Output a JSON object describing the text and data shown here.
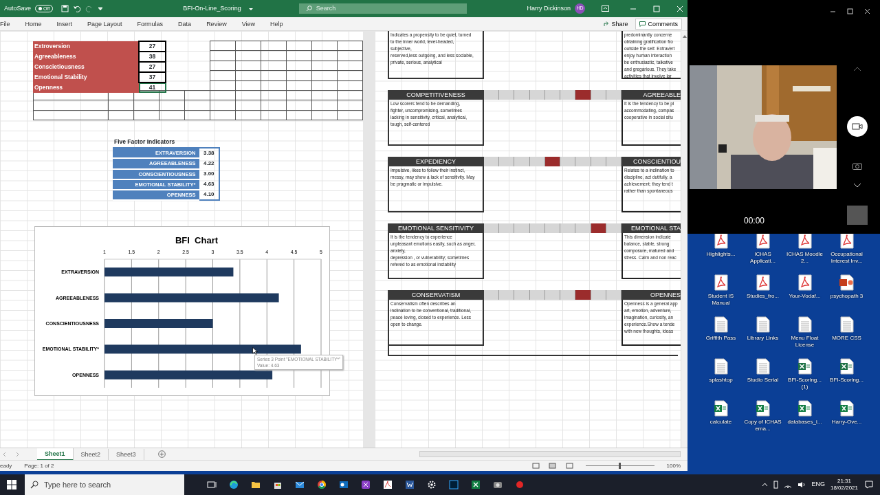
{
  "title_bar": {
    "autosave_label": "AutoSave",
    "autosave_state": "Off",
    "autosave_on": false,
    "filename": "BFI-On-Line_Scoring",
    "search_placeholder": "Search",
    "user": "Harry Dickinson",
    "initials": "HD"
  },
  "ribbon": {
    "tabs": [
      {
        "label": "File",
        "selected": false
      },
      {
        "label": "Home",
        "selected": false
      },
      {
        "label": "Insert",
        "selected": false
      },
      {
        "label": "Page Layout",
        "selected": false
      },
      {
        "label": "Formulas",
        "selected": false
      },
      {
        "label": "Data",
        "selected": false
      },
      {
        "label": "Review",
        "selected": false
      },
      {
        "label": "View",
        "selected": false
      },
      {
        "label": "Help",
        "selected": false
      }
    ],
    "share": "Share",
    "comments": "Comments"
  },
  "raw_scores": [
    {
      "label": "Extroversion",
      "value": "27",
      "selected": false
    },
    {
      "label": "Agreeableness",
      "value": "38",
      "selected": false
    },
    {
      "label": "Conscietiousness",
      "value": "27",
      "selected": false
    },
    {
      "label": "Emotional Stability",
      "value": "37",
      "selected": false
    },
    {
      "label": "Openness",
      "value": "41",
      "selected": true
    }
  ],
  "indicators": {
    "title": "Five Factor Indicators",
    "rows": [
      {
        "label": "EXTRAVERSION",
        "value": "3.38"
      },
      {
        "label": "AGREEABLENESS",
        "value": "4.22"
      },
      {
        "label": "CONSCIENTIOUSNESS",
        "value": "3.00"
      },
      {
        "label": "EMOTIONAL STABILITY*",
        "value": "4.63"
      },
      {
        "label": "OPENNESS",
        "value": "4.10"
      }
    ]
  },
  "chart": {
    "chart_data": {
      "type": "bar",
      "orientation": "horizontal",
      "title": "BFI  Chart",
      "categories": [
        "EXTRAVERSION",
        "AGREEABLENESS",
        "CONSCIENTIOUSNESS",
        "EMOTIONAL STABILITY*",
        "OPENNESS"
      ],
      "series": [
        {
          "color": "#1f3a5f",
          "values": [
            3.38,
            4.22,
            3.0,
            4.63,
            4.1
          ]
        }
      ],
      "grid": true,
      "xlim": [
        1,
        5
      ],
      "xticks": [
        1,
        1.5,
        2,
        2.5,
        3,
        3.5,
        4,
        4.5,
        5
      ]
    },
    "tooltip": {
      "point": "Series 3 Point \"EMOTIONAL STABILITY*\"",
      "value": "Value: 4.63"
    }
  },
  "profile": {
    "top_left": [
      "Indicates a propensity to be quiet, turned",
      "to the inner world, level-headed,",
      "subjective,",
      "reserved,less outgoing, and less sociable,",
      "private, serious, analytical"
    ],
    "top_right": [
      "predominantly concerne",
      "obtaining gratification fro",
      "outside the self. Extravert",
      "enjoy human interaction",
      "be enthusiastic, talkative",
      "and gregarious. They take",
      "activities that involve lar"
    ],
    "scales": [
      {
        "low": "COMPETITIVENESS",
        "low_text": [
          "Low scorers tend to be demanding,",
          "fighter, uncompromising, sometimes",
          "lacking in sensitivity, critical, analytical,",
          "tough, self-centered"
        ],
        "high": "AGREEABLE",
        "high_text": [
          "It is the tendency to be pl",
          "accommodating, compas",
          "cooperative in social situ"
        ],
        "cells": [
          {
            "marked": false
          },
          {
            "marked": false
          },
          {
            "marked": false
          },
          {
            "marked": false
          },
          {
            "marked": false
          },
          {
            "marked": false
          },
          {
            "marked": true
          },
          {
            "marked": false
          },
          {
            "marked": false
          }
        ]
      },
      {
        "low": "EXPEDIENCY",
        "low_text": [
          "Impulsive, likes to follow their instinct,",
          "messy, may show a lack of sensitivity. May",
          "be pragmatic or impulsive."
        ],
        "high": "CONSCIENTIOU",
        "high_text": [
          "Relates to a inclination to",
          "discipline, act dutifully, a",
          "achievement; they tend t",
          "rather than spontaneous"
        ],
        "cells": [
          {
            "marked": false
          },
          {
            "marked": false
          },
          {
            "marked": false
          },
          {
            "marked": false
          },
          {
            "marked": true
          },
          {
            "marked": false
          },
          {
            "marked": false
          },
          {
            "marked": false
          },
          {
            "marked": false
          }
        ]
      },
      {
        "low": "EMOTIONAL SENSITIVITY",
        "low_text": [
          "It is the tendency to experience",
          "unpleasant emotions easily, such as anger,",
          "anxiety,",
          "depression , or vulnerability; sometimes",
          "refered to as emotional instability"
        ],
        "high": "EMOTIONAL STA",
        "high_text": [
          "This dimension indicate",
          "balance, stable, strong",
          "composure, matured and",
          "stress. Calm and non reac"
        ],
        "cells": [
          {
            "marked": false
          },
          {
            "marked": false
          },
          {
            "marked": false
          },
          {
            "marked": false
          },
          {
            "marked": false
          },
          {
            "marked": false
          },
          {
            "marked": false
          },
          {
            "marked": true
          },
          {
            "marked": false
          }
        ]
      },
      {
        "low": "CONSERVATISM",
        "low_text": [
          "Conservatism often describes an",
          "inclination to be conventional, traditional,",
          "peace loving, closed to experience. Less",
          "open to change."
        ],
        "high": "OPENNES",
        "high_text": [
          "Openness is a general app",
          "art, emotion, adventure,",
          "imagination, curiosity, an",
          "experience.Show a tende",
          "with new thoughts, ideas"
        ],
        "cells": [
          {
            "marked": false
          },
          {
            "marked": false
          },
          {
            "marked": false
          },
          {
            "marked": false
          },
          {
            "marked": false
          },
          {
            "marked": false
          },
          {
            "marked": true
          },
          {
            "marked": false
          },
          {
            "marked": false
          }
        ]
      }
    ]
  },
  "sheet_tabs": [
    {
      "label": "Sheet1",
      "selected": true
    },
    {
      "label": "Sheet2",
      "selected": false
    },
    {
      "label": "Sheet3",
      "selected": false
    }
  ],
  "status_bar": {
    "mode": "eady",
    "page": "Page: 1 of 2",
    "zoom": "100%",
    "zoom_slider": {
      "level": 0.5
    }
  },
  "video": {
    "timer": "00:00"
  },
  "desktop_icons": [
    {
      "label": "Highlights...",
      "kind": "pdf"
    },
    {
      "label": "ICHAS Applicati...",
      "kind": "pdf"
    },
    {
      "label": "ICHAS Moodle 2...",
      "kind": "pdf"
    },
    {
      "label": "Occupational Interest Inv...",
      "kind": "pdf"
    },
    {
      "label": "Student IS Manual",
      "kind": "pdf"
    },
    {
      "label": "Studies_fro...",
      "kind": "pdf"
    },
    {
      "label": "Your-Vodaf...",
      "kind": "pdf"
    },
    {
      "label": "psychopath 3",
      "kind": "ppt"
    },
    {
      "label": "Griffith Pass",
      "kind": "txt"
    },
    {
      "label": "Library Links",
      "kind": "txt"
    },
    {
      "label": "Menu Float License",
      "kind": "txt"
    },
    {
      "label": "MORE CSS",
      "kind": "txt"
    },
    {
      "label": "splashtop",
      "kind": "txt"
    },
    {
      "label": "Studio Serial",
      "kind": "txt"
    },
    {
      "label": "BFI-Scoring... (1)",
      "kind": "xls"
    },
    {
      "label": "BFI-Scoring...",
      "kind": "xls"
    },
    {
      "label": "calculate",
      "kind": "xlsx"
    },
    {
      "label": "Copy of ICHAS ema...",
      "kind": "xlsx"
    },
    {
      "label": "databases_i...",
      "kind": "xlsx"
    },
    {
      "label": "Harry-Ove...",
      "kind": "xlsx"
    }
  ],
  "taskbar": {
    "search_placeholder": "Type here to search",
    "language": "ENG",
    "time": "21:31",
    "date": "18/02/2021"
  }
}
